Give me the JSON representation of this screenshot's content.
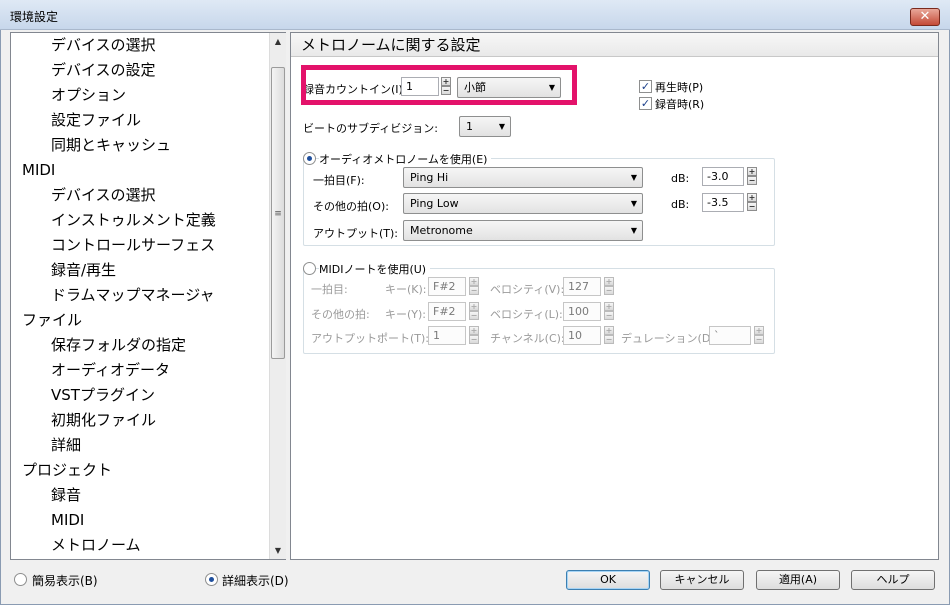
{
  "window": {
    "title": "環境設定",
    "close_icon": "✕"
  },
  "tree": {
    "items": [
      {
        "label": "デバイスの選択",
        "level": 1
      },
      {
        "label": "デバイスの設定",
        "level": 1
      },
      {
        "label": "オプション",
        "level": 1
      },
      {
        "label": "設定ファイル",
        "level": 1
      },
      {
        "label": "同期とキャッシュ",
        "level": 1
      },
      {
        "label": "MIDI",
        "level": 0
      },
      {
        "label": "デバイスの選択",
        "level": 1
      },
      {
        "label": "インストゥルメント定義",
        "level": 1
      },
      {
        "label": "コントロールサーフェス",
        "level": 1
      },
      {
        "label": "録音/再生",
        "level": 1
      },
      {
        "label": "ドラムマップマネージャ",
        "level": 1
      },
      {
        "label": "ファイル",
        "level": 0
      },
      {
        "label": "保存フォルダの指定",
        "level": 1
      },
      {
        "label": "オーディオデータ",
        "level": 1
      },
      {
        "label": "VSTプラグイン",
        "level": 1
      },
      {
        "label": "初期化ファイル",
        "level": 1
      },
      {
        "label": "詳細",
        "level": 1
      },
      {
        "label": "プロジェクト",
        "level": 0
      },
      {
        "label": "録音",
        "level": 1
      },
      {
        "label": "MIDI",
        "level": 1
      },
      {
        "label": "メトロノーム",
        "level": 1
      }
    ],
    "scroll_up": "▲",
    "scroll_down": "▼",
    "thumb_grip": "≡"
  },
  "panel": {
    "title": "メトロノームに関する設定",
    "countin": {
      "label": "録音カウントイン(I):",
      "value": "1",
      "unit": "小節"
    },
    "on_play": {
      "label": "再生時(P)",
      "checked": true
    },
    "on_rec": {
      "label": "録音時(R)",
      "checked": true
    },
    "subdivision": {
      "label": "ビートのサブディビジョン:",
      "value": "1"
    },
    "audio": {
      "label": "オーディオメトロノームを使用(E)",
      "first_beat_label": "一拍目(F):",
      "first_beat_value": "Ping Hi",
      "first_db_label": "dB:",
      "first_db_value": "-3.0",
      "other_beat_label": "その他の拍(O):",
      "other_beat_value": "Ping Low",
      "other_db_label": "dB:",
      "other_db_value": "-3.5",
      "output_label": "アウトプット(T):",
      "output_value": "Metronome"
    },
    "midi": {
      "label": "MIDIノートを使用(U)",
      "first_label": "一拍目:",
      "key_k_label": "キー(K):",
      "key_k_value": "F#2",
      "vel_v_label": "ベロシティ(V):",
      "vel_v_value": "127",
      "other_label": "その他の拍:",
      "key_y_label": "キー(Y):",
      "key_y_value": "F#2",
      "vel_l_label": "ベロシティ(L):",
      "vel_l_value": "100",
      "output_label": "アウトプット:",
      "port_label": "ポート(T):",
      "port_value": "1",
      "channel_label": "チャンネル(C):",
      "channel_value": "10",
      "duration_label": "デュレーション(D):",
      "duration_value": "`"
    },
    "spin_up": "+",
    "spin_down": "−",
    "combo_arrow": "▼",
    "check_mark": "✓"
  },
  "footer": {
    "simple": "簡易表示(B)",
    "detailed": "詳細表示(D)",
    "ok": "OK",
    "cancel": "キャンセル",
    "apply": "適用(A)",
    "help": "ヘルプ"
  },
  "colors": {
    "highlight": "#e3126a",
    "radio_dot": "#1f4f9d"
  }
}
